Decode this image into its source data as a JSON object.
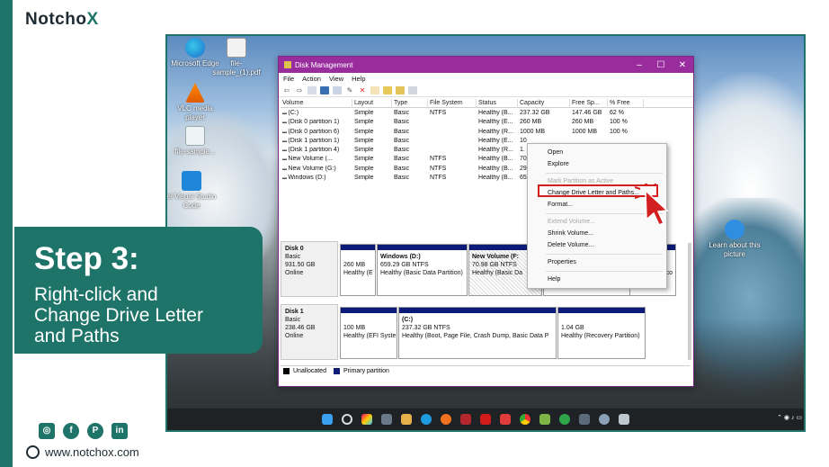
{
  "brand": {
    "name_main": "Notcho",
    "name_accent": "X"
  },
  "desktop_icons": [
    {
      "label": "Microsoft Edge"
    },
    {
      "label": "file-sample_(1).pdf"
    },
    {
      "label": "VLC media player"
    },
    {
      "label": "file-sample..."
    },
    {
      "label": "el Visual Studio Code"
    },
    {
      "label": "Learn about this picture"
    }
  ],
  "window": {
    "title": "Disk Management",
    "menu": [
      "File",
      "Action",
      "View",
      "Help"
    ],
    "columns": [
      "Volume",
      "Layout",
      "Type",
      "File System",
      "Status",
      "Capacity",
      "Free Sp...",
      "% Free"
    ],
    "volumes": [
      [
        "(C:)",
        "Simple",
        "Basic",
        "NTFS",
        "Healthy (B...",
        "237.32 GB",
        "147.46 GB",
        "62 %"
      ],
      [
        "(Disk 0 partition 1)",
        "Simple",
        "Basic",
        "",
        "Healthy (E...",
        "260 MB",
        "260 MB",
        "100 %"
      ],
      [
        "(Disk 0 partition 6)",
        "Simple",
        "Basic",
        "",
        "Healthy (R...",
        "1000 MB",
        "1000 MB",
        "100 %"
      ],
      [
        "(Disk 1 partition 1)",
        "Simple",
        "Basic",
        "",
        "Healthy (E...",
        "10",
        "",
        ""
      ],
      [
        "(Disk 1 partition 4)",
        "Simple",
        "Basic",
        "",
        "Healthy (R...",
        "1.",
        "",
        ""
      ],
      [
        "New Volume (...",
        "Simple",
        "Basic",
        "NTFS",
        "Healthy (B...",
        "70",
        "",
        ""
      ],
      [
        "New Volume (G:)",
        "Simple",
        "Basic",
        "NTFS",
        "Healthy (B...",
        "29",
        "",
        ""
      ],
      [
        "Windows (D:)",
        "Simple",
        "Basic",
        "NTFS",
        "Healthy (B...",
        "65",
        "",
        ""
      ]
    ],
    "disk0": {
      "name": "Disk 0",
      "type": "Basic",
      "size": "931.50 GB",
      "status": "Online",
      "p1": {
        "size": "260 MB",
        "status": "Healthy (E"
      },
      "p2": {
        "name": "Windows (D:)",
        "size": "659.29 GB NTFS",
        "status": "Healthy (Basic Data Partition)"
      },
      "p3": {
        "name": "New Volume (F:",
        "size": "70.98 GB NTFS",
        "status": "Healthy (Basic Da"
      },
      "p4": {
        "status": "co"
      }
    },
    "disk1": {
      "name": "Disk 1",
      "type": "Basic",
      "size": "238.46 GB",
      "status": "Online",
      "p1": {
        "size": "100 MB",
        "status": "Healthy (EFI Syste"
      },
      "p2": {
        "name": "(C:)",
        "size": "237.32 GB NTFS",
        "status": "Healthy (Boot, Page File, Crash Dump, Basic Data P"
      },
      "p3": {
        "size": "1.04 GB",
        "status": "Healthy (Recovery Partition)"
      }
    },
    "legend": {
      "unallocated": "Unallocated",
      "primary": "Primary partition"
    }
  },
  "context_menu": {
    "open": "Open",
    "explore": "Explore",
    "mark_active": "Mark Partition as Active",
    "change_letter": "Change Drive Letter and Paths...",
    "format": "Format...",
    "extend": "Extend Volume...",
    "shrink": "Shrink Volume...",
    "delete": "Delete Volume...",
    "properties": "Properties",
    "help": "Help"
  },
  "step": {
    "title": "Step 3:",
    "line1": "Right-click and",
    "line2": "Change Drive Letter",
    "line3": "and Paths"
  },
  "footer": {
    "website": "www.notchox.com"
  },
  "colors": {
    "brand_teal": "#1e7468",
    "title_bar": "#9a2d9d",
    "highlight_red": "#d31f1f",
    "partition_bar": "#0c1a78"
  }
}
